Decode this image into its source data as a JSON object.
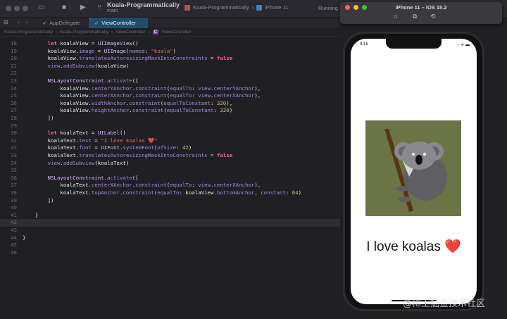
{
  "toolbar": {
    "project": "Koala-Programmatically",
    "branch": "main",
    "scheme": "Koala-Programmatically",
    "device": "iPhone 11",
    "status": "Running"
  },
  "tabs": [
    {
      "label": "AppDelegate"
    },
    {
      "label": "ViewController"
    }
  ],
  "breadcrumb": [
    "Koala-Programmatically",
    "Koala-Programmatically",
    "ViewController",
    "ViewController"
  ],
  "code": {
    "current_line": 42,
    "lines": [
      {
        "n": "18",
        "i": 2,
        "t": [
          [
            "k",
            "let "
          ],
          [
            "p",
            "koalaView = "
          ],
          [
            "t",
            "UIImageView"
          ],
          [
            "p",
            "()"
          ]
        ]
      },
      {
        "n": "19",
        "i": 2,
        "t": [
          [
            "p",
            "koalaView."
          ],
          [
            "m",
            "image"
          ],
          [
            "p",
            " = "
          ],
          [
            "t",
            "UIImage"
          ],
          [
            "p",
            "("
          ],
          [
            "m",
            "named"
          ],
          [
            "p",
            ": "
          ],
          [
            "s",
            "\"koala\""
          ],
          [
            "p",
            ")"
          ]
        ]
      },
      {
        "n": "20",
        "i": 2,
        "t": [
          [
            "p",
            "koalaView."
          ],
          [
            "m",
            "translatesAutoresizingMaskIntoConstraints"
          ],
          [
            "p",
            " = "
          ],
          [
            "k",
            "false"
          ]
        ]
      },
      {
        "n": "21",
        "i": 2,
        "t": [
          [
            "m",
            "view"
          ],
          [
            "p",
            "."
          ],
          [
            "m",
            "addSubview"
          ],
          [
            "p",
            "(koalaView)"
          ]
        ]
      },
      {
        "n": "22",
        "i": 0,
        "t": []
      },
      {
        "n": "23",
        "i": 2,
        "t": [
          [
            "t",
            "NSLayoutConstraint"
          ],
          [
            "p",
            "."
          ],
          [
            "m",
            "activate"
          ],
          [
            "p",
            "(["
          ]
        ]
      },
      {
        "n": "24",
        "i": 3,
        "t": [
          [
            "p",
            "koalaView."
          ],
          [
            "m",
            "centerYAnchor"
          ],
          [
            "p",
            "."
          ],
          [
            "m",
            "constraint"
          ],
          [
            "p",
            "("
          ],
          [
            "m",
            "equalTo"
          ],
          [
            "p",
            ": "
          ],
          [
            "m",
            "view"
          ],
          [
            "p",
            "."
          ],
          [
            "m",
            "centerYAnchor"
          ],
          [
            "p",
            "),"
          ]
        ]
      },
      {
        "n": "25",
        "i": 3,
        "t": [
          [
            "p",
            "koalaView."
          ],
          [
            "m",
            "centerXAnchor"
          ],
          [
            "p",
            "."
          ],
          [
            "m",
            "constraint"
          ],
          [
            "p",
            "("
          ],
          [
            "m",
            "equalTo"
          ],
          [
            "p",
            ": "
          ],
          [
            "m",
            "view"
          ],
          [
            "p",
            "."
          ],
          [
            "m",
            "centerXAnchor"
          ],
          [
            "p",
            "),"
          ]
        ]
      },
      {
        "n": "26",
        "i": 3,
        "t": [
          [
            "p",
            "koalaView."
          ],
          [
            "m",
            "widthAnchor"
          ],
          [
            "p",
            "."
          ],
          [
            "m",
            "constraint"
          ],
          [
            "p",
            "("
          ],
          [
            "m",
            "equalToConstant"
          ],
          [
            "p",
            ": "
          ],
          [
            "n",
            "320"
          ],
          [
            "p",
            "),"
          ]
        ]
      },
      {
        "n": "27",
        "i": 3,
        "t": [
          [
            "p",
            "koalaView."
          ],
          [
            "m",
            "heightAnchor"
          ],
          [
            "p",
            "."
          ],
          [
            "m",
            "constraint"
          ],
          [
            "p",
            "("
          ],
          [
            "m",
            "equalToConstant"
          ],
          [
            "p",
            ": "
          ],
          [
            "n",
            "320"
          ],
          [
            "p",
            ")"
          ]
        ]
      },
      {
        "n": "28",
        "i": 2,
        "t": [
          [
            "p",
            "])"
          ]
        ]
      },
      {
        "n": "29",
        "i": 0,
        "t": []
      },
      {
        "n": "30",
        "i": 2,
        "t": [
          [
            "k",
            "let "
          ],
          [
            "p",
            "koalaText = "
          ],
          [
            "t",
            "UILabel"
          ],
          [
            "p",
            "()"
          ]
        ]
      },
      {
        "n": "31",
        "i": 2,
        "t": [
          [
            "p",
            "koalaText."
          ],
          [
            "m",
            "text"
          ],
          [
            "p",
            " = "
          ],
          [
            "s",
            "\"I love koalas ❤️\""
          ]
        ]
      },
      {
        "n": "32",
        "i": 2,
        "t": [
          [
            "p",
            "koalaText."
          ],
          [
            "m",
            "font"
          ],
          [
            "p",
            " = "
          ],
          [
            "t",
            "UIFont"
          ],
          [
            "p",
            "."
          ],
          [
            "m",
            "systemFont"
          ],
          [
            "p",
            "("
          ],
          [
            "m",
            "ofSize"
          ],
          [
            "p",
            ": "
          ],
          [
            "n",
            "42"
          ],
          [
            "p",
            ")"
          ]
        ]
      },
      {
        "n": "33",
        "i": 2,
        "t": [
          [
            "p",
            "koalaText."
          ],
          [
            "m",
            "translatesAutoresizingMaskIntoConstraints"
          ],
          [
            "p",
            " = "
          ],
          [
            "k",
            "false"
          ]
        ]
      },
      {
        "n": "34",
        "i": 2,
        "t": [
          [
            "m",
            "view"
          ],
          [
            "p",
            "."
          ],
          [
            "m",
            "addSubview"
          ],
          [
            "p",
            "(koalaText)"
          ]
        ]
      },
      {
        "n": "35",
        "i": 0,
        "t": []
      },
      {
        "n": "36",
        "i": 2,
        "t": [
          [
            "t",
            "NSLayoutConstraint"
          ],
          [
            "p",
            "."
          ],
          [
            "m",
            "activate"
          ],
          [
            "p",
            "(["
          ]
        ]
      },
      {
        "n": "37",
        "i": 3,
        "t": [
          [
            "p",
            "koalaText."
          ],
          [
            "m",
            "centerXAnchor"
          ],
          [
            "p",
            "."
          ],
          [
            "m",
            "constraint"
          ],
          [
            "p",
            "("
          ],
          [
            "m",
            "equalTo"
          ],
          [
            "p",
            ": "
          ],
          [
            "m",
            "view"
          ],
          [
            "p",
            "."
          ],
          [
            "m",
            "centerXAnchor"
          ],
          [
            "p",
            "),"
          ]
        ]
      },
      {
        "n": "38",
        "i": 3,
        "t": [
          [
            "p",
            "koalaText."
          ],
          [
            "m",
            "topAnchor"
          ],
          [
            "p",
            "."
          ],
          [
            "m",
            "constraint"
          ],
          [
            "p",
            "("
          ],
          [
            "m",
            "equalTo"
          ],
          [
            "p",
            ": koalaView."
          ],
          [
            "m",
            "bottomAnchor"
          ],
          [
            "p",
            ", "
          ],
          [
            "m",
            "constant"
          ],
          [
            "p",
            ": "
          ],
          [
            "n",
            "64"
          ],
          [
            "p",
            ")"
          ]
        ]
      },
      {
        "n": "39",
        "i": 2,
        "t": [
          [
            "p",
            "])"
          ]
        ]
      },
      {
        "n": "40",
        "i": 0,
        "t": []
      },
      {
        "n": "41",
        "i": 1,
        "t": [
          [
            "p",
            "}"
          ]
        ]
      },
      {
        "n": "42",
        "i": 0,
        "t": []
      },
      {
        "n": "43",
        "i": 0,
        "t": []
      },
      {
        "n": "44",
        "i": 0,
        "t": [
          [
            "p",
            "}"
          ]
        ]
      },
      {
        "n": "45",
        "i": 0,
        "t": []
      },
      {
        "n": "46",
        "i": 0,
        "t": []
      }
    ]
  },
  "simulator": {
    "title": "iPhone 11 – iOS 15.2",
    "time": "9:16",
    "label": "I love koalas ❤️"
  },
  "watermark": "@稀土掘金技术社区",
  "colors": {
    "accent_tab": "#1f4e6d",
    "koala_bg": "#6b7447"
  }
}
